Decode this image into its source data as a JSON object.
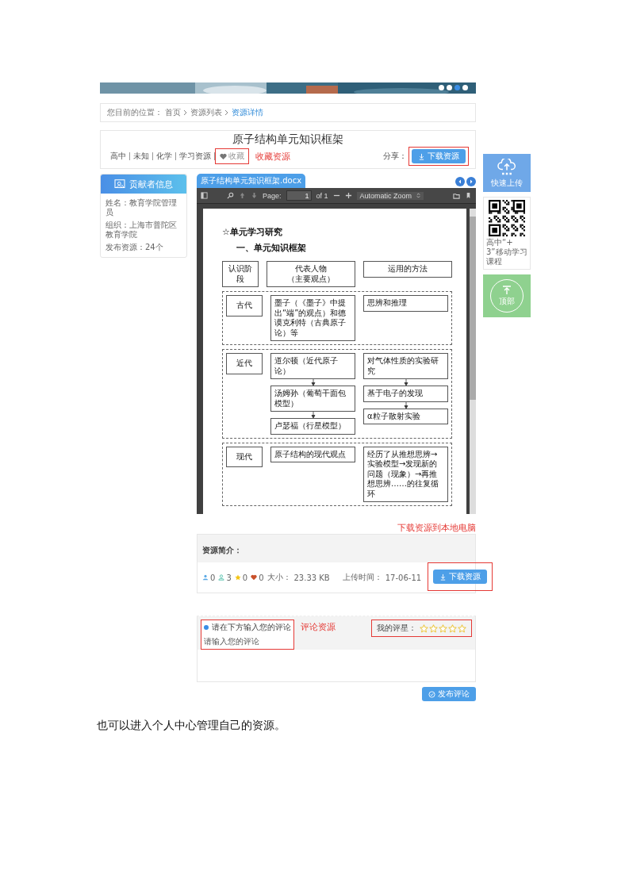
{
  "banner": {
    "dots": [
      {
        "selected": false
      },
      {
        "selected": false
      },
      {
        "selected": true
      },
      {
        "selected": false
      }
    ]
  },
  "breadcrumb": {
    "prefix": "您目前的位置：",
    "items": [
      {
        "label": "首页",
        "selected": false
      },
      {
        "label": "资源列表",
        "selected": false
      },
      {
        "label": "资源详情",
        "selected": true
      }
    ]
  },
  "resource": {
    "title": "原子结构单元知识框架",
    "tags": [
      "高中",
      "未知",
      "化学",
      "学习资源"
    ],
    "favorite": "收藏",
    "favorite_note": "收藏资源",
    "share_label": "分享：",
    "download_button": "下载资源"
  },
  "contributor": {
    "title": "贡献者信息",
    "fields": [
      "姓名：教育学院管理员",
      "组织：上海市普陀区教育学院",
      "发布资源：24个"
    ]
  },
  "viewer": {
    "tab": "原子结构单元知识框架.docx",
    "toolbar": {
      "page_label": "Page:",
      "page": "1",
      "page_count": "of 1",
      "zoom": "Automatic Zoom"
    },
    "document": {
      "heading": "☆单元学习研究",
      "subheading": "一、单元知识框架",
      "header": [
        {
          "label": "认识阶段"
        },
        {
          "label": "代表人物",
          "note": "（主要观点）"
        },
        {
          "label": "运用的方法"
        }
      ],
      "eras": [
        {
          "stage": "古代",
          "people": [
            "墨子（《墨子》中提出“端”的观点）和德谟克利特（古典原子论）等"
          ],
          "methods": [
            "思辨和推理"
          ]
        },
        {
          "stage": "近代",
          "people": [
            "道尔顿（近代原子论）",
            "汤姆孙（葡萄干面包模型）",
            "卢瑟福（行星模型）"
          ],
          "methods": [
            "对气体性质的实验研究",
            "基于电子的发现",
            "α粒子散射实验"
          ]
        },
        {
          "stage": "现代",
          "people": [
            "原子结构的现代观点"
          ],
          "methods": [
            "经历了从推想思辨→实验模型→发现新的问题（现象）→再推想思辨……的往复循环"
          ]
        }
      ]
    }
  },
  "download_note": "下载资源到本地电脑",
  "intro": {
    "label": "资源简介：",
    "stats": [
      {
        "kind": "user",
        "value": "0"
      },
      {
        "kind": "member",
        "value": "3"
      },
      {
        "kind": "star",
        "value": "0"
      },
      {
        "kind": "heart",
        "value": "0"
      }
    ],
    "size_label": "大小：",
    "size": "23.33 KB",
    "upload_label": "上传时间：",
    "upload_time": "17-06-11",
    "download_button": "下载资源"
  },
  "comments": {
    "hint": "请在下方输入您的评论",
    "note": "评论资源",
    "rating_label": "我的评星：",
    "stars": 0,
    "placeholder": "请输入您的评论",
    "submit_button": "发布评论"
  },
  "sidebar": {
    "upload": "快速上传",
    "qr_caption": "高中“+3”移动学习课程",
    "top": "顶部"
  },
  "caption": "也可以进入个人中心管理自己的资源。"
}
